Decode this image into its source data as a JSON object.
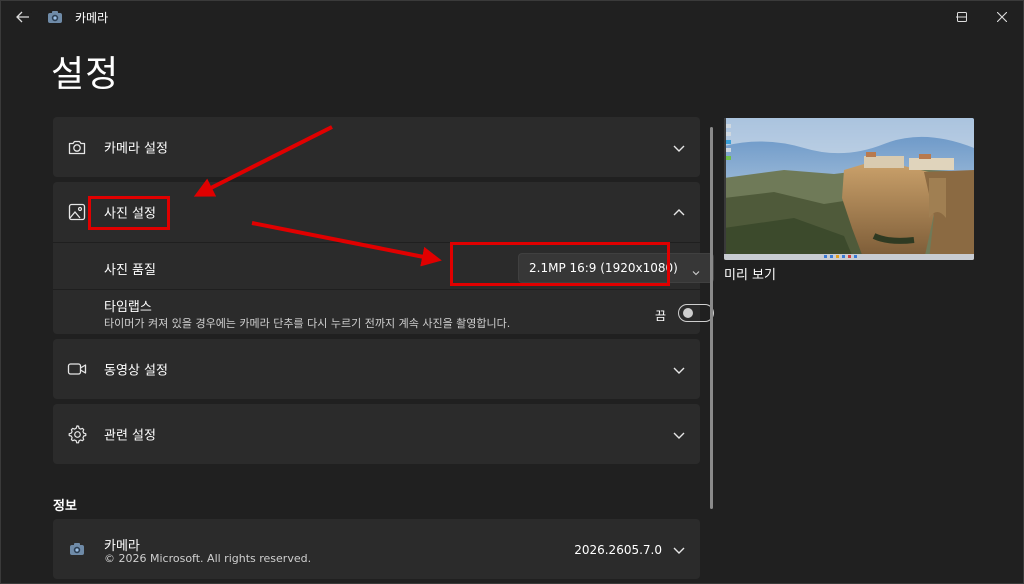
{
  "titlebar": {
    "app_title": "카메라",
    "back_icon": "back-arrow-icon",
    "app_icon": "camera-app-icon",
    "controls": [
      "minimize-icon",
      "maximize-icon",
      "close-icon"
    ]
  },
  "page": {
    "title": "설정"
  },
  "sections": {
    "camera_settings": {
      "label": "카메라 설정",
      "icon": "camera-icon"
    },
    "photo_settings": {
      "label": "사진 설정",
      "icon": "image-icon",
      "expanded": true,
      "photo_quality": {
        "label": "사진 품질",
        "value": "2.1MP 16:9 (1920x1080)"
      },
      "timelapse": {
        "label": "타임랩스",
        "description": "타이머가 켜져 있을 경우에는 카메라 단추를 다시 누르기 전까지 계속 사진을 촬영합니다.",
        "state_label": "끔",
        "on": false
      }
    },
    "video_settings": {
      "label": "동영상 설정",
      "icon": "video-icon"
    },
    "related_settings": {
      "label": "관련 설정",
      "icon": "gear-icon"
    }
  },
  "info": {
    "section_title": "정보",
    "app_name": "카메라",
    "copyright": "© 2026 Microsoft. All rights reserved.",
    "version": "2026.2605.7.0"
  },
  "preview": {
    "label": "미리 보기"
  },
  "annotation_color": "#e00000"
}
